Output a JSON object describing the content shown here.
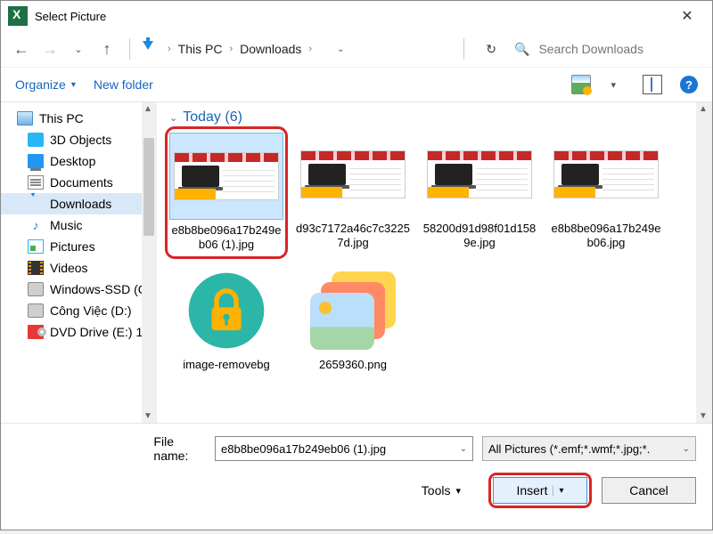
{
  "titlebar": {
    "title": "Select Picture"
  },
  "nav": {
    "breadcrumb": [
      "This PC",
      "Downloads"
    ],
    "search_placeholder": "Search Downloads"
  },
  "toolbar": {
    "organize": "Organize",
    "newfolder": "New folder"
  },
  "tree": {
    "items": [
      {
        "label": "This PC",
        "icon": "pc"
      },
      {
        "label": "3D Objects",
        "icon": "3d"
      },
      {
        "label": "Desktop",
        "icon": "desk"
      },
      {
        "label": "Documents",
        "icon": "doc"
      },
      {
        "label": "Downloads",
        "icon": "dl",
        "selected": true
      },
      {
        "label": "Music",
        "icon": "mus"
      },
      {
        "label": "Pictures",
        "icon": "pics"
      },
      {
        "label": "Videos",
        "icon": "vid"
      },
      {
        "label": "Windows-SSD (C",
        "icon": "hdd"
      },
      {
        "label": "Công Việc (D:)",
        "icon": "hdd"
      },
      {
        "label": "DVD Drive (E:) 1",
        "icon": "dvd"
      }
    ]
  },
  "pane": {
    "group_label": "Today (6)",
    "files": [
      {
        "name": "e8b8be096a17b249eb06 (1).jpg",
        "kind": "product",
        "selected": true,
        "highlight": true
      },
      {
        "name": "d93c7172a46c7c32257d.jpg",
        "kind": "product"
      },
      {
        "name": "58200d91d98f01d1589e.jpg",
        "kind": "product"
      },
      {
        "name": "e8b8be096a17b249eb06.jpg",
        "kind": "product"
      },
      {
        "name": "image-removebg",
        "kind": "lock"
      },
      {
        "name": "2659360.png",
        "kind": "pngstack"
      }
    ]
  },
  "bottom": {
    "filename_label": "File name:",
    "filename_value": "e8b8be096a17b249eb06 (1).jpg",
    "filter_value": "All Pictures (*.emf;*.wmf;*.jpg;*.",
    "tools": "Tools",
    "insert": "Insert",
    "cancel": "Cancel"
  }
}
